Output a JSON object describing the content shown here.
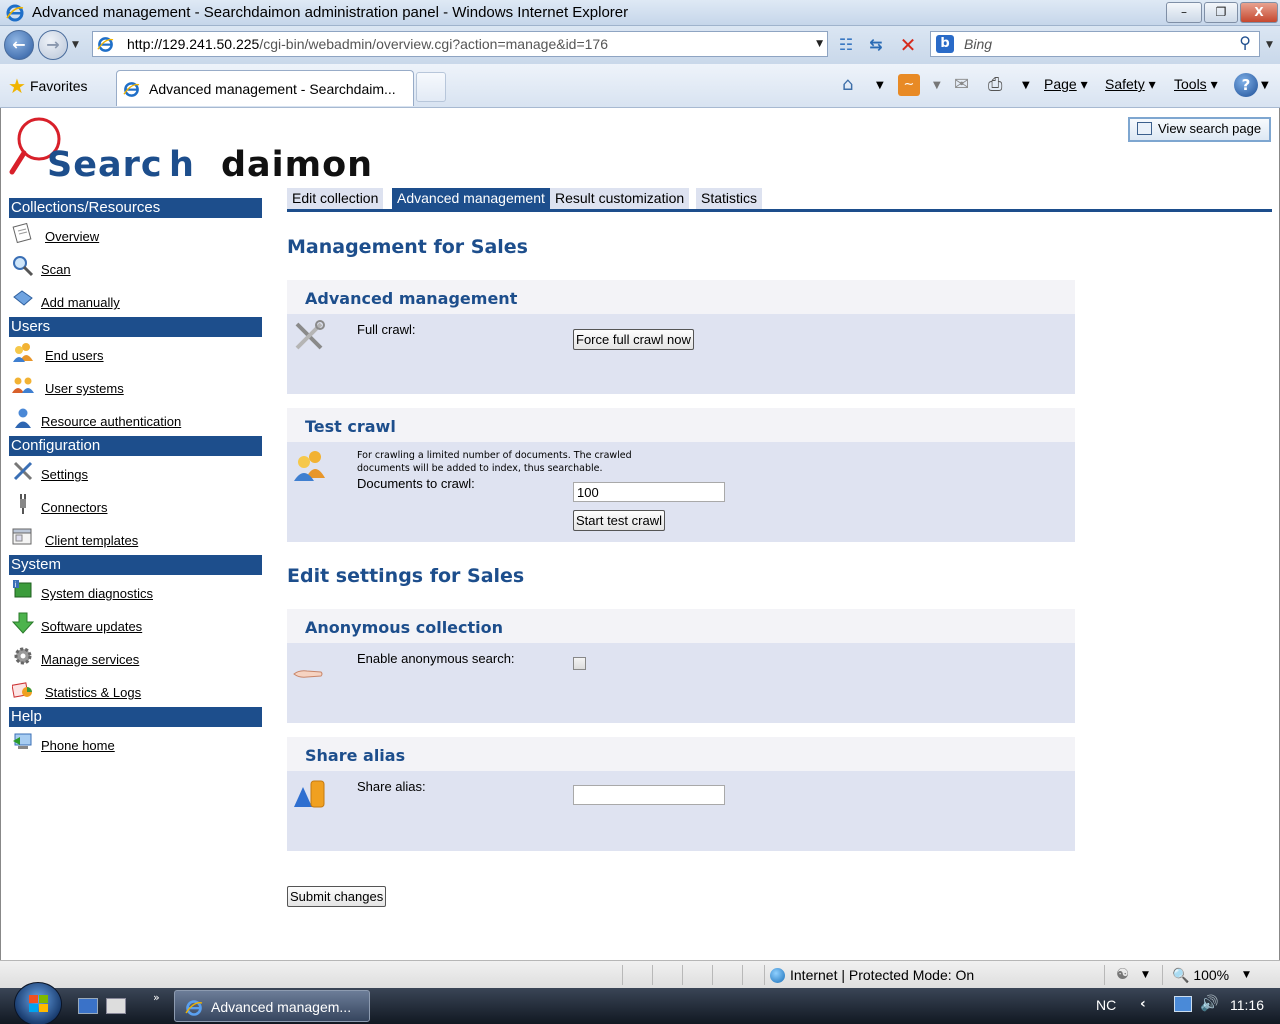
{
  "window": {
    "title": "Advanced management - Searchdaimon administration panel - Windows Internet Explorer",
    "minimize": "–",
    "maximize": "❐",
    "close": "X"
  },
  "address_bar": {
    "url_scheme_host": "http://129.241.50.225",
    "url_path": "/cgi-bin/webadmin/overview.cgi?action=manage&id=176",
    "search_placeholder": "Bing"
  },
  "favorites_bar": {
    "favorites_label": "Favorites",
    "tab_title": "Advanced management - Searchdaim...",
    "commands": {
      "page": "Page",
      "safety": "Safety",
      "tools": "Tools",
      "help": "?"
    }
  },
  "header": {
    "view_search_button": "View search page"
  },
  "sidebar": {
    "sections": [
      {
        "title": "Collections/Resources",
        "items": [
          "Overview",
          "Scan",
          "Add manually"
        ]
      },
      {
        "title": "Users",
        "items": [
          "End users",
          "User systems",
          "Resource authentication"
        ]
      },
      {
        "title": "Configuration",
        "items": [
          "Settings",
          "Connectors",
          "Client templates"
        ]
      },
      {
        "title": "System",
        "items": [
          "System diagnostics",
          "Software updates",
          "Manage services",
          "Statistics & Logs"
        ]
      },
      {
        "title": "Help",
        "items": [
          "Phone home"
        ]
      }
    ]
  },
  "tabs": [
    "Edit collection",
    "Advanced management",
    "Result customization",
    "Statistics"
  ],
  "main": {
    "management_title": "Management for Sales",
    "advanced": {
      "title": "Advanced management",
      "full_crawl_label": "Full crawl:",
      "force_button": "Force full crawl now"
    },
    "test_crawl": {
      "title": "Test crawl",
      "description": "For crawling a limited number of documents. The crawled documents will be added to index, thus searchable.",
      "docs_label": "Documents to crawl:",
      "docs_value": "100",
      "start_button": "Start test crawl"
    },
    "edit_title": "Edit settings for Sales",
    "anonymous": {
      "title": "Anonymous collection",
      "label": "Enable anonymous search:",
      "checked": false
    },
    "share_alias": {
      "title": "Share alias",
      "label": "Share alias:",
      "value": ""
    },
    "submit_button": "Submit changes"
  },
  "status_bar": {
    "zone": "Internet | Protected Mode: On",
    "zoom": "100%"
  },
  "taskbar": {
    "task_label": "Advanced managem...",
    "language": "NC",
    "clock": "11:16"
  }
}
